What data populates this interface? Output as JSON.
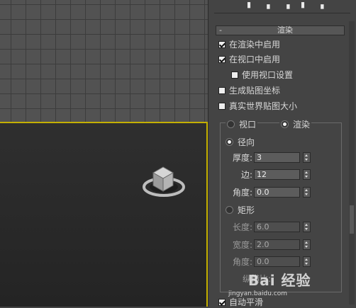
{
  "rollout": {
    "collapse_symbol": "-",
    "title": "渲染"
  },
  "options": {
    "enable_in_renderer": {
      "label": "在渲染中启用",
      "checked": true
    },
    "enable_in_viewport": {
      "label": "在视口中启用",
      "checked": true
    },
    "use_viewport_settings": {
      "label": "使用视口设置",
      "checked": false
    },
    "generate_mapping_coords": {
      "label": "生成贴图坐标",
      "checked": false
    },
    "real_world_map_size": {
      "label": "真实世界贴图大小",
      "checked": false
    },
    "auto_smooth": {
      "label": "自动平滑",
      "checked": true
    }
  },
  "mode": {
    "viewport_label": "视口",
    "renderer_label": "渲染",
    "selected": "渲染"
  },
  "radial": {
    "label": "径向",
    "selected": true,
    "thickness": {
      "label": "厚度:",
      "value": "3"
    },
    "sides": {
      "label": "边:",
      "value": "12"
    },
    "angle": {
      "label": "角度:",
      "value": "0.0"
    }
  },
  "rectangular": {
    "label": "矩形",
    "selected": false,
    "length": {
      "label": "长度:",
      "value": "6.0"
    },
    "width": {
      "label": "宽度:",
      "value": "2.0"
    },
    "angle": {
      "label": "角度:",
      "value": "0.0"
    },
    "aspect": {
      "label": "纵横比:"
    }
  },
  "watermark": {
    "brand": "Bai 经验",
    "url": "jingyan.baidu.com"
  }
}
